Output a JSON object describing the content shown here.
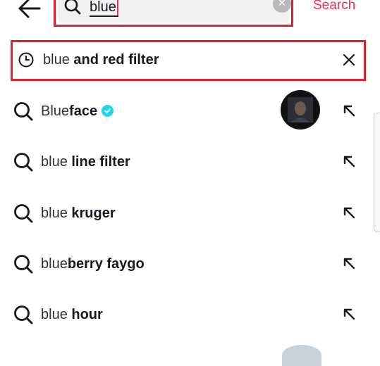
{
  "search": {
    "query": "blue",
    "action_label": "Search",
    "clear_icon": "close-icon",
    "search_icon": "search-icon",
    "back_icon": "back-arrow-icon"
  },
  "history": {
    "prefix": "blue",
    "suffix": " and red filter",
    "icon": "clock-icon",
    "remove_icon": "close-icon"
  },
  "suggestions": [
    {
      "prefix": "Blue",
      "suffix": "face",
      "verified": true,
      "has_avatar": true
    },
    {
      "prefix": "blue",
      "suffix": " line filter"
    },
    {
      "prefix": "blue",
      "suffix": " kruger"
    },
    {
      "prefix": "blue",
      "suffix": "berry faygo"
    },
    {
      "prefix": "blue",
      "suffix": " hour"
    }
  ],
  "colors": {
    "accent": "#fe2c55",
    "highlight_border": "#e0202a",
    "verified": "#20d5ec"
  }
}
